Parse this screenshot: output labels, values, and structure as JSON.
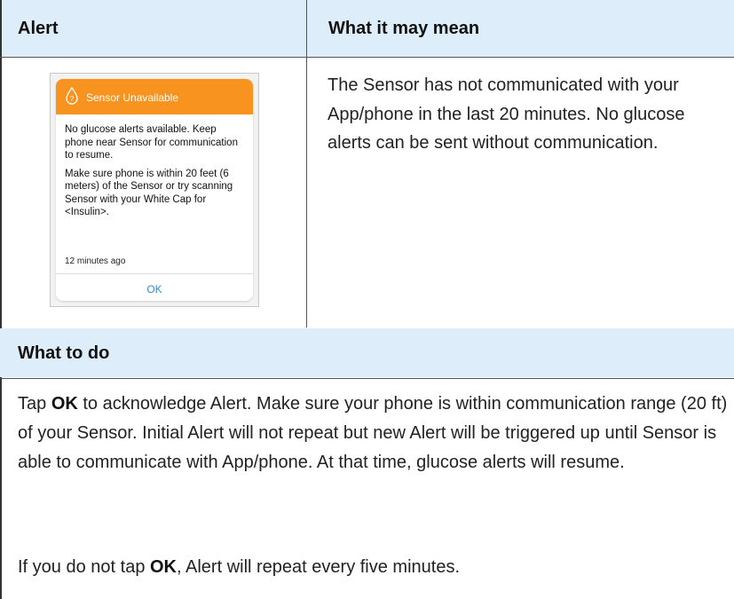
{
  "table": {
    "col1_header": "Alert",
    "col2_header": "What it may mean"
  },
  "alert_card": {
    "icon": "question-drop-icon",
    "title": "Sensor Unavailable",
    "body_1": "No glucose alerts available. Keep phone near Sensor for communication to resume.",
    "body_2": "Make sure phone is within 20 feet (6 meters) of the Sensor or try scanning Sensor with your White Cap for <Insulin>.",
    "timestamp": "12 minutes ago",
    "button": "OK",
    "header_color": "#f7931e",
    "button_color": "#2d8fd6"
  },
  "meaning": "The Sensor has not communicated with your App/phone in the last 20 minutes. No glucose alerts can be sent without communication.",
  "todo": {
    "header": "What to do",
    "p1_before": "Tap ",
    "p1_bold": "OK",
    "p1_after": " to acknowledge Alert. Make sure your phone is within communication range (20 ft) of your Sensor. Initial Alert will not repeat but new Alert will be triggered up until Sensor is able to communicate with App/phone. At that time, glucose alerts will resume.",
    "p2_before": "If you do not tap ",
    "p2_bold": "OK",
    "p2_after": ", Alert will repeat every five minutes."
  },
  "header_bg": "#ddeefa"
}
